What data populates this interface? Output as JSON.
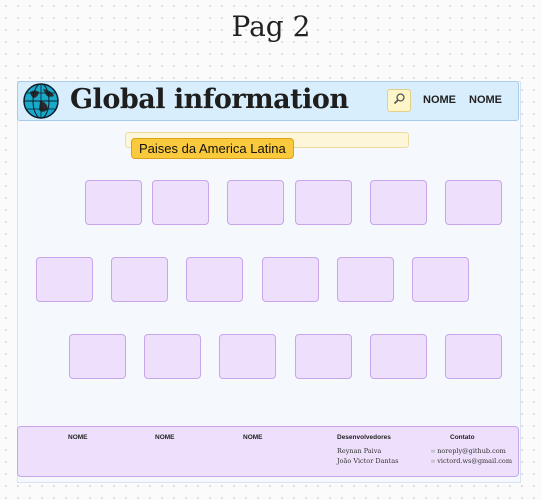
{
  "page_label": "Pag 2",
  "header": {
    "title": "Global information",
    "nav": [
      "NOME",
      "NOME"
    ],
    "icons": [
      "globe-icon",
      "search-icon"
    ]
  },
  "section": {
    "badge": "Paises da America Latina",
    "rows": [
      6,
      6,
      6
    ]
  },
  "footer": {
    "columns": [
      "NOME",
      "NOME",
      "NOME"
    ],
    "developers": {
      "title": "Desenvolvedores",
      "names": [
        "Reynan Paiva",
        "João Victor Dantas"
      ]
    },
    "contact": {
      "title": "Contato",
      "emails": [
        "noreply@github.com",
        "victord.ws@gmail.com"
      ]
    }
  },
  "colors": {
    "header_bg": "#d9eefc",
    "badge_bg": "#fbc93c",
    "card_bg": "#eee0fc",
    "card_border": "#c7a6ea"
  }
}
